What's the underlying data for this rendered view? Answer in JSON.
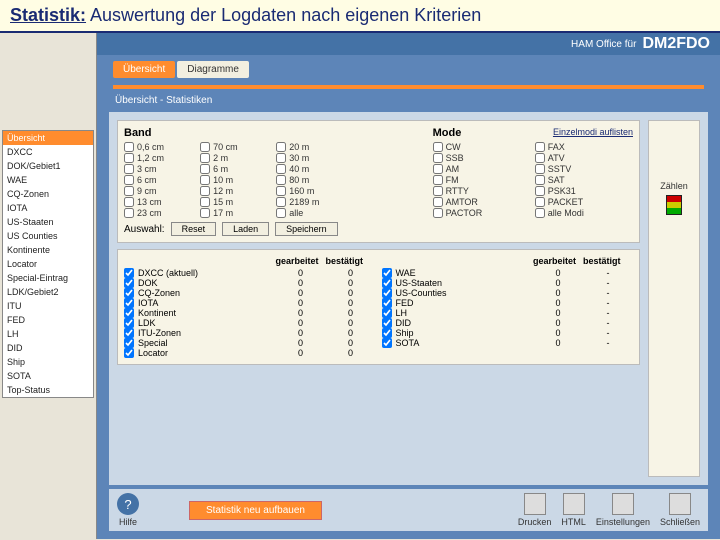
{
  "page_title": {
    "prefix": "Statistik:",
    "rest": " Auswertung der Logdaten nach eigenen Kriterien"
  },
  "topbar": {
    "label": "HAM Office für",
    "callsign": "DM2FDO"
  },
  "tabs": [
    {
      "label": "Übersicht",
      "active": true
    },
    {
      "label": "Diagramme",
      "active": false
    }
  ],
  "crumb": "Übersicht - Statistiken",
  "left_nav": [
    "Übersicht",
    "DXCC",
    "DOK/Gebiet1",
    "WAE",
    "CQ-Zonen",
    "IOTA",
    "US-Staaten",
    "US Counties",
    "Kontinente",
    "Locator",
    "Special-Eintrag",
    "LDK/Gebiet2",
    "ITU",
    "FED",
    "LH",
    "DID",
    "Ship",
    "SOTA",
    "Top-Status"
  ],
  "band": {
    "title": "Band",
    "link": "",
    "cols": [
      [
        "0,6 cm",
        "1,2 cm",
        "3 cm",
        "6 cm",
        "9 cm",
        "13 cm",
        "23 cm"
      ],
      [
        "70 cm",
        "2 m",
        "6 m",
        "10 m",
        "12 m",
        "15 m",
        "17 m"
      ],
      [
        "20 m",
        "30 m",
        "40 m",
        "80 m",
        "160 m",
        "2189 m",
        "alle"
      ],
      []
    ]
  },
  "mode": {
    "title": "Mode",
    "link": "Einzelmodi auflisten",
    "cols": [
      [
        "CW",
        "SSB",
        "AM",
        "FM",
        "RTTY",
        "AMTOR",
        "PACTOR"
      ],
      [
        "FAX",
        "ATV",
        "SSTV",
        "SAT",
        "PSK31",
        "PACKET",
        "alle Modi"
      ]
    ]
  },
  "auswahl": {
    "label": "Auswahl:",
    "reset": "Reset",
    "laden": "Laden",
    "speichern": "Speichern"
  },
  "side": {
    "label": "Zählen"
  },
  "stats": {
    "head": [
      "",
      "",
      "gearbeitet",
      "bestätigt"
    ],
    "left": [
      {
        "n": "DXCC (aktuell)",
        "g": "0",
        "b": "0"
      },
      {
        "n": "DOK",
        "g": "0",
        "b": "0"
      },
      {
        "n": "CQ-Zonen",
        "g": "0",
        "b": "0"
      },
      {
        "n": "IOTA",
        "g": "0",
        "b": "0"
      },
      {
        "n": "Kontinent",
        "g": "0",
        "b": "0"
      },
      {
        "n": "LDK",
        "g": "0",
        "b": "0"
      },
      {
        "n": "ITU-Zonen",
        "g": "0",
        "b": "0"
      },
      {
        "n": "Special",
        "g": "0",
        "b": "0"
      },
      {
        "n": "Locator",
        "g": "0",
        "b": "0"
      }
    ],
    "right": [
      {
        "n": "WAE",
        "g": "0",
        "b": "-"
      },
      {
        "n": "US-Staaten",
        "g": "0",
        "b": "-"
      },
      {
        "n": "US-Counties",
        "g": "0",
        "b": "-"
      },
      {
        "n": "FED",
        "g": "0",
        "b": "-"
      },
      {
        "n": "LH",
        "g": "0",
        "b": "-"
      },
      {
        "n": "DID",
        "g": "0",
        "b": "-"
      },
      {
        "n": "Ship",
        "g": "0",
        "b": "-"
      },
      {
        "n": "SOTA",
        "g": "0",
        "b": "-"
      }
    ]
  },
  "footer": {
    "hilfe": "Hilfe",
    "rebuild": "Statistik neu aufbauen",
    "drucken": "Drucken",
    "html": "HTML",
    "einstellungen": "Einstellungen",
    "schliessen": "Schließen"
  }
}
